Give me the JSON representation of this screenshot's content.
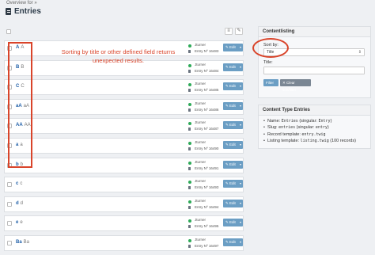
{
  "header": {
    "breadcrumb": "Overview for »",
    "title": "Entries"
  },
  "list": {
    "header_buttons": [
      "≡",
      "✎"
    ],
    "rows": [
      {
        "title": "A",
        "sub": "A",
        "author": "Jturner",
        "entry": "Entry Nº 16483",
        "edit": "Edit"
      },
      {
        "title": "B",
        "sub": "B",
        "author": "Jturner",
        "entry": "Entry Nº 16484",
        "edit": "Edit"
      },
      {
        "title": "C",
        "sub": "C",
        "author": "Jturner",
        "entry": "Entry Nº 16485",
        "edit": "Edit"
      },
      {
        "title": "aA",
        "sub": "aA",
        "author": "Jturner",
        "entry": "Entry Nº 16486",
        "edit": "Edit"
      },
      {
        "title": "AA",
        "sub": "AA",
        "author": "Jturner",
        "entry": "Entry Nº 16487",
        "edit": "Edit"
      },
      {
        "title": "a",
        "sub": "a",
        "author": "Jturner",
        "entry": "Entry Nº 16490",
        "edit": "Edit"
      },
      {
        "title": "b",
        "sub": "b",
        "author": "Jturner",
        "entry": "Entry Nº 16491",
        "edit": "Edit"
      },
      {
        "title": "c",
        "sub": "c",
        "author": "Jturner",
        "entry": "Entry Nº 16493",
        "edit": "Edit"
      },
      {
        "title": "d",
        "sub": "d",
        "author": "Jturner",
        "entry": "Entry Nº 16494",
        "edit": "Edit"
      },
      {
        "title": "e",
        "sub": "e",
        "author": "Jturner",
        "entry": "Entry Nº 16495",
        "edit": "Edit"
      },
      {
        "title": "Ba",
        "sub": "Ba",
        "author": "Jturner",
        "entry": "Entry Nº 16497",
        "edit": "Edit"
      }
    ]
  },
  "annotation": {
    "text": "Sorting by title or other defined field returns unexpected results."
  },
  "contentlisting": {
    "heading": "Contentlisting",
    "sort_label": "Sort by:",
    "sort_value": "Title",
    "title_label": "Title:",
    "filter_btn": "Filter",
    "clear_btn": "✕ Clear sort/filter"
  },
  "content_type": {
    "heading": "Content Type Entries",
    "name_prefix": "Name: ",
    "name_code": "Entries",
    "name_suffix": " (singular: ",
    "name_singular": "Entry",
    "name_close": ")",
    "slug_prefix": "Slug: ",
    "slug_code": "entries",
    "slug_suffix": " (singular: ",
    "slug_singular": "entry",
    "slug_close": ")",
    "record_prefix": "Record template: ",
    "record_code": "entry.twig",
    "listing_prefix": "Listing template: ",
    "listing_code": "listing.twig",
    "listing_suffix": " (100 records)"
  },
  "colors": {
    "accent": "#6b9ec4",
    "annotation": "#d9442a",
    "status_published": "#2eaa58"
  }
}
